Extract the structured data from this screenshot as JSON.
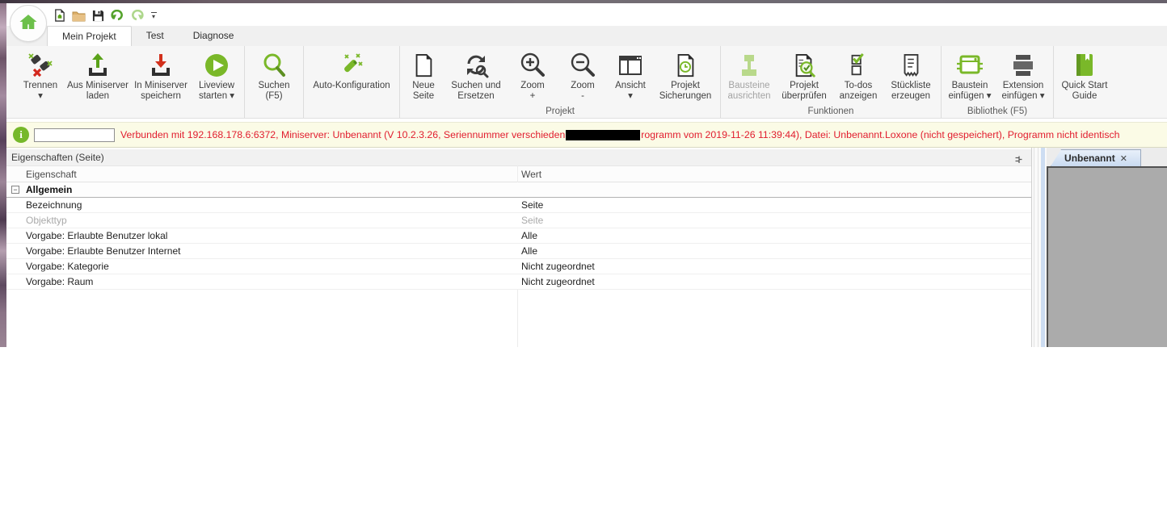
{
  "quick_access": {
    "icons": [
      "new-file-icon",
      "open-folder-icon",
      "save-icon",
      "undo-icon",
      "redo-icon",
      "toolbar-options-icon"
    ]
  },
  "tabs": [
    {
      "label": "Mein Projekt",
      "active": true
    },
    {
      "label": "Test",
      "active": false
    },
    {
      "label": "Diagnose",
      "active": false
    }
  ],
  "ribbon": {
    "groups": [
      {
        "label": "",
        "buttons": [
          {
            "line1": "Trennen",
            "line2": "▾",
            "icon": "disconnect-icon"
          },
          {
            "line1": "Aus Miniserver",
            "line2": "laden",
            "icon": "upload-icon"
          },
          {
            "line1": "In Miniserver",
            "line2": "speichern",
            "icon": "download-icon"
          },
          {
            "line1": "Liveview",
            "line2": "starten ▾",
            "icon": "play-icon"
          }
        ]
      },
      {
        "label": "",
        "buttons": [
          {
            "line1": "Suchen",
            "line2": "(F5)",
            "icon": "search-icon"
          }
        ]
      },
      {
        "label": "",
        "buttons": [
          {
            "line1": "Auto-Konfiguration",
            "line2": "",
            "icon": "magic-wand-icon"
          }
        ]
      },
      {
        "label": "Projekt",
        "buttons": [
          {
            "line1": "Neue",
            "line2": "Seite",
            "icon": "new-page-icon"
          },
          {
            "line1": "Suchen und",
            "line2": "Ersetzen",
            "icon": "search-replace-icon"
          },
          {
            "line1": "Zoom",
            "line2": "+",
            "icon": "zoom-in-icon"
          },
          {
            "line1": "Zoom",
            "line2": "-",
            "icon": "zoom-out-icon"
          },
          {
            "line1": "Ansicht",
            "line2": "▾",
            "icon": "view-icon"
          },
          {
            "line1": "Projekt",
            "line2": "Sicherungen",
            "icon": "project-backup-icon"
          }
        ]
      },
      {
        "label": "Funktionen",
        "buttons": [
          {
            "line1": "Bausteine",
            "line2": "ausrichten",
            "icon": "align-blocks-icon",
            "disabled": true
          },
          {
            "line1": "Projekt",
            "line2": "überprüfen",
            "icon": "check-project-icon"
          },
          {
            "line1": "To-dos",
            "line2": "anzeigen",
            "icon": "todos-icon"
          },
          {
            "line1": "Stückliste",
            "line2": "erzeugen",
            "icon": "parts-list-icon"
          }
        ]
      },
      {
        "label": "Bibliothek (F5)",
        "buttons": [
          {
            "line1": "Baustein",
            "line2": "einfügen ▾",
            "icon": "insert-block-icon"
          },
          {
            "line1": "Extension",
            "line2": "einfügen ▾",
            "icon": "insert-extension-icon"
          }
        ]
      },
      {
        "label": "",
        "buttons": [
          {
            "line1": "Quick Start",
            "line2": "Guide",
            "icon": "quickstart-icon"
          }
        ]
      }
    ]
  },
  "statusbar": {
    "icon": "info-icon",
    "input_value": "",
    "message_part1": "Verbunden mit 192.168.178.6:6372, Miniserver: Unbenannt (V 10.2.3.26, Seriennummer verschieden",
    "message_part2": "rogramm vom 2019-11-26 11:39:44), Datei: Unbenannt.Loxone (nicht gespeichert), Programm nicht identisch",
    "message_color": "#e11d2e"
  },
  "properties": {
    "title": "Eigenschaften (Seite)",
    "pin_icon": "pin-icon",
    "columns": {
      "name": "Eigenschaft",
      "value": "Wert"
    },
    "group_label": "Allgemein",
    "expander_state": "−",
    "rows": [
      {
        "name": "Bezeichnung",
        "value": "Seite",
        "muted": false
      },
      {
        "name": "Objekttyp",
        "value": "Seite",
        "muted": true
      },
      {
        "name": "Vorgabe: Erlaubte Benutzer lokal",
        "value": "Alle",
        "muted": false
      },
      {
        "name": "Vorgabe: Erlaubte Benutzer Internet",
        "value": "Alle",
        "muted": false
      },
      {
        "name": "Vorgabe: Kategorie",
        "value": "Nicht zugeordnet",
        "muted": false
      },
      {
        "name": "Vorgabe: Raum",
        "value": "Nicht zugeordnet",
        "muted": false
      }
    ]
  },
  "document": {
    "tab_label": "Unbenannt",
    "close_icon": "close-icon",
    "close_glyph": "✕"
  },
  "colors": {
    "accent_green": "#76b82a",
    "status_bg": "#fbfbe6",
    "status_text": "#e11d2e",
    "canvas_gray": "#ababab",
    "doc_tab_blue": "#cfdff2"
  }
}
